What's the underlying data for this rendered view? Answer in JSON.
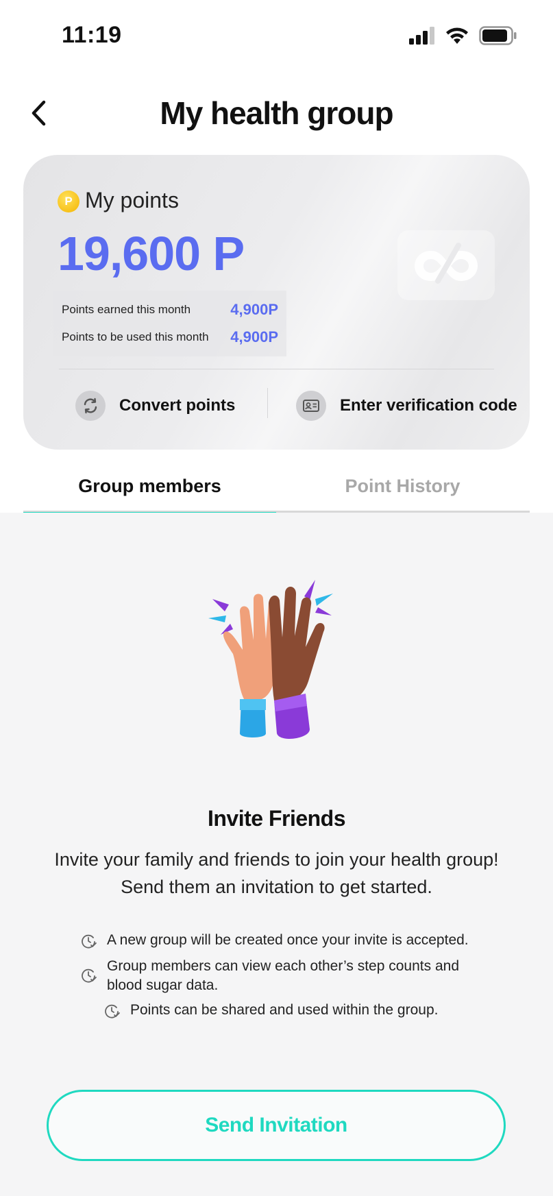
{
  "status_bar": {
    "time": "11:19"
  },
  "header": {
    "title": "My health group"
  },
  "points_card": {
    "label": "My points",
    "coin_symbol": "P",
    "total": "19,600 P",
    "rows": [
      {
        "label": "Points earned this month",
        "value": "4,900P"
      },
      {
        "label": "Points to be used this month",
        "value": "4,900P"
      }
    ],
    "actions": [
      {
        "label": "Convert points",
        "icon": "convert-icon"
      },
      {
        "label": "Enter verification code",
        "icon": "id-card-icon"
      }
    ],
    "accent_color": "#5a6cf0"
  },
  "tabs": [
    {
      "label": "Group members",
      "active": true
    },
    {
      "label": "Point History",
      "active": false
    }
  ],
  "invite": {
    "title": "Invite Friends",
    "description_line1": "Invite your family and friends to join your health group!",
    "description_line2": "Send them an invitation to get started.",
    "bullets": [
      "A new group will be created once your invite is accepted.",
      "Group members can view each other’s step counts and blood sugar data.",
      "Points can be shared and used within the group."
    ],
    "button_label": "Send Invitation",
    "accent_color": "#1fd9c0"
  }
}
